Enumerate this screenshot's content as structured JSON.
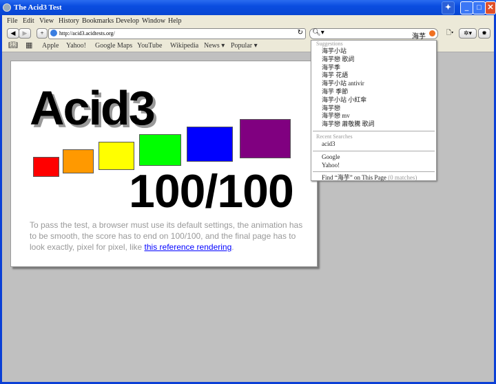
{
  "window": {
    "title": "The Acid3 Test"
  },
  "menu": [
    "File",
    "Edit",
    "View",
    "History",
    "Bookmarks",
    "Develop",
    "Window",
    "Help"
  ],
  "toolbar": {
    "url": "http://acid3.acidtests.org/",
    "search_value": "海芋"
  },
  "bookmarks": [
    "Apple",
    "Yahoo!",
    "Google Maps",
    "YouTube",
    "Wikipedia",
    "News ▾",
    "Popular ▾"
  ],
  "page": {
    "heading": "Acid3",
    "score": "100/100",
    "text": "To pass the test, a browser must use its default settings, the animation has to be smooth, the score has to end on 100/100, and the final page has to look exactly, pixel for pixel, like ",
    "link": "this reference rendering",
    "end": ".",
    "squares": [
      "#ff0000",
      "#ff9900",
      "#ffff00",
      "#00ff00",
      "#0000ff",
      "#800080"
    ]
  },
  "dropdown": {
    "suggestions_header": "Suggestions",
    "suggestions": [
      "海芋小站",
      "海芋戀 歌詞",
      "海芋季",
      "海芋 花語",
      "海芋小站 antivir",
      "海芋 季節",
      "海芋小站 小紅傘",
      "海芋戀",
      "海芋戀 mv",
      "海芋戀 蕭敬騰 歌詞"
    ],
    "recent_header": "Recent Searches",
    "recent": [
      "acid3"
    ],
    "engines": [
      "Google",
      "Yahoo!"
    ],
    "find_label": "Find",
    "find_query": "“海芋”",
    "find_suffix": "on This Page",
    "find_matches": "(0 matches)"
  }
}
